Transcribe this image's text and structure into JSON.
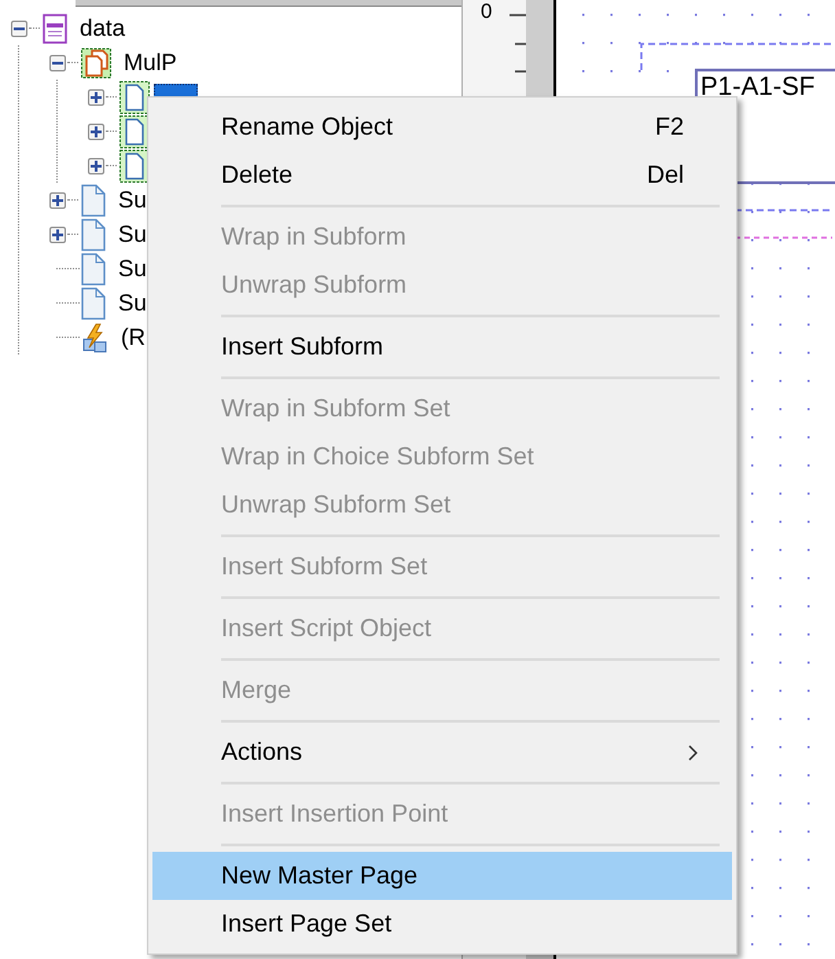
{
  "tree": [
    {
      "label": "data",
      "kind": "dataset",
      "expanded": true,
      "selected": false,
      "children": [
        {
          "label": "MulP",
          "kind": "pages",
          "expanded": true,
          "selected": false,
          "children": [
            {
              "kind": "page",
              "expanded": false,
              "selected": true
            },
            {
              "kind": "page",
              "expanded": false,
              "selected": false
            },
            {
              "kind": "page",
              "expanded": false,
              "selected": false
            }
          ]
        },
        {
          "label": "Su",
          "kind": "subform",
          "expanded": false,
          "selected": false
        },
        {
          "label": "Su",
          "kind": "subform",
          "expanded": false,
          "selected": false
        },
        {
          "label": "Su",
          "kind": "subform",
          "selected": false
        },
        {
          "label": "Su",
          "kind": "subform",
          "selected": false
        },
        {
          "label": "(R",
          "kind": "script",
          "selected": false
        }
      ]
    }
  ],
  "ruler": {
    "label": "0"
  },
  "canvas": {
    "field": "P1-A1-SF"
  },
  "context_menu": [
    {
      "kind": "item",
      "label": "Rename Object",
      "shortcut": "F2",
      "disabled": false,
      "selected": false
    },
    {
      "kind": "item",
      "label": "Delete",
      "shortcut": "Del",
      "disabled": false,
      "selected": false
    },
    {
      "kind": "separator"
    },
    {
      "kind": "item",
      "label": "Wrap in Subform",
      "disabled": true,
      "selected": false
    },
    {
      "kind": "item",
      "label": "Unwrap Subform",
      "disabled": true,
      "selected": false
    },
    {
      "kind": "separator"
    },
    {
      "kind": "item",
      "label": "Insert Subform",
      "disabled": false,
      "selected": false
    },
    {
      "kind": "separator"
    },
    {
      "kind": "item",
      "label": "Wrap in Subform Set",
      "disabled": true,
      "selected": false
    },
    {
      "kind": "item",
      "label": "Wrap in Choice Subform Set",
      "disabled": true,
      "selected": false
    },
    {
      "kind": "item",
      "label": "Unwrap Subform Set",
      "disabled": true,
      "selected": false
    },
    {
      "kind": "separator"
    },
    {
      "kind": "item",
      "label": "Insert Subform Set",
      "disabled": true,
      "selected": false
    },
    {
      "kind": "separator"
    },
    {
      "kind": "item",
      "label": "Insert Script Object",
      "disabled": true,
      "selected": false
    },
    {
      "kind": "separator"
    },
    {
      "kind": "item",
      "label": "Merge",
      "disabled": true,
      "selected": false
    },
    {
      "kind": "separator"
    },
    {
      "kind": "submenu",
      "label": "Actions",
      "disabled": false,
      "selected": false
    },
    {
      "kind": "separator"
    },
    {
      "kind": "item",
      "label": "Insert Insertion Point",
      "disabled": true,
      "selected": false
    },
    {
      "kind": "separator"
    },
    {
      "kind": "item",
      "label": "New Master Page",
      "disabled": false,
      "selected": true
    },
    {
      "kind": "item",
      "label": "Insert Page Set",
      "disabled": false,
      "selected": false
    }
  ]
}
